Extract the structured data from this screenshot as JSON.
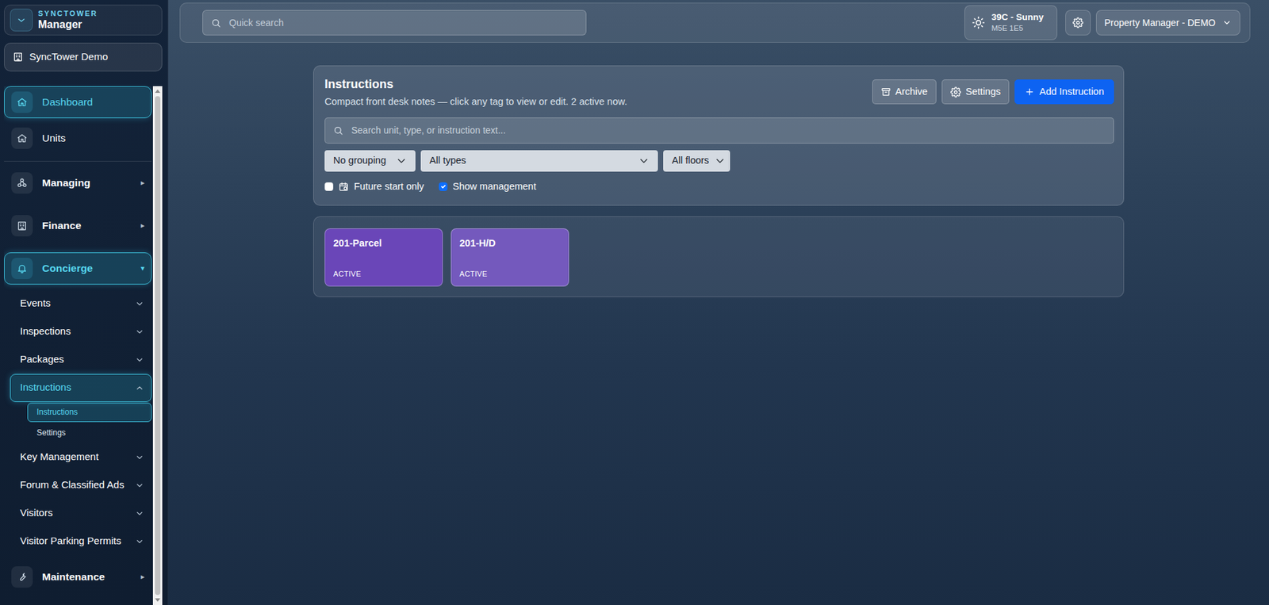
{
  "brand": {
    "kicker": "SYNCTOWER",
    "title": "Manager"
  },
  "building": {
    "label": "SyncTower Demo"
  },
  "sidebar": {
    "items": [
      {
        "kind": "top",
        "label": "Dashboard",
        "selected": true
      },
      {
        "kind": "top",
        "label": "Units",
        "selected": false
      },
      {
        "kind": "section",
        "label": "Managing",
        "caret": "▸",
        "selected": false,
        "expanded": false
      },
      {
        "kind": "section",
        "label": "Finance",
        "caret": "▸",
        "selected": false,
        "expanded": false
      },
      {
        "kind": "section",
        "label": "Concierge",
        "caret": "▾",
        "selected": true,
        "expanded": true
      },
      {
        "kind": "sub",
        "label": "Events",
        "selected": false,
        "expanded": false
      },
      {
        "kind": "sub",
        "label": "Inspections",
        "selected": false,
        "expanded": false
      },
      {
        "kind": "sub",
        "label": "Packages",
        "selected": false,
        "expanded": false
      },
      {
        "kind": "sub",
        "label": "Instructions",
        "selected": true,
        "expanded": true
      },
      {
        "kind": "leaf",
        "label": "Instructions",
        "selected": true
      },
      {
        "kind": "leaf",
        "label": "Settings",
        "selected": false
      },
      {
        "kind": "sub",
        "label": "Key Management",
        "selected": false,
        "expanded": false
      },
      {
        "kind": "sub",
        "label": "Forum & Classified Ads",
        "selected": false,
        "expanded": false
      },
      {
        "kind": "sub",
        "label": "Visitors",
        "selected": false,
        "expanded": false
      },
      {
        "kind": "sub",
        "label": "Visitor Parking Permits",
        "selected": false,
        "expanded": false
      },
      {
        "kind": "section",
        "label": "Maintenance",
        "caret": "▸",
        "selected": false,
        "expanded": false
      }
    ]
  },
  "topbar": {
    "search_placeholder": "Quick search",
    "weather": {
      "reading": "39C - Sunny",
      "postal": "M5E 1E5"
    },
    "user": "Property Manager - DEMO"
  },
  "panel": {
    "title": "Instructions",
    "subtitle": "Compact front desk notes — click any tag to view or edit. 2 active now.",
    "buttons": [
      {
        "label": "Archive",
        "kind": "secondary"
      },
      {
        "label": "Settings",
        "kind": "secondary"
      },
      {
        "label": "Add Instruction",
        "kind": "primary"
      }
    ],
    "search_placeholder": "Search unit, type, or instruction text...",
    "filters": [
      {
        "value": "No grouping"
      },
      {
        "value": "All types"
      },
      {
        "value": "All floors"
      }
    ],
    "checkboxes": [
      {
        "label": "Future start only",
        "checked": false
      },
      {
        "label": "Show management",
        "checked": true
      }
    ]
  },
  "tags": [
    {
      "label": "201-Parcel",
      "status": "ACTIVE",
      "color": "#6a46b8"
    },
    {
      "label": "201-H/D",
      "status": "ACTIVE",
      "color": "#7459bd"
    }
  ]
}
